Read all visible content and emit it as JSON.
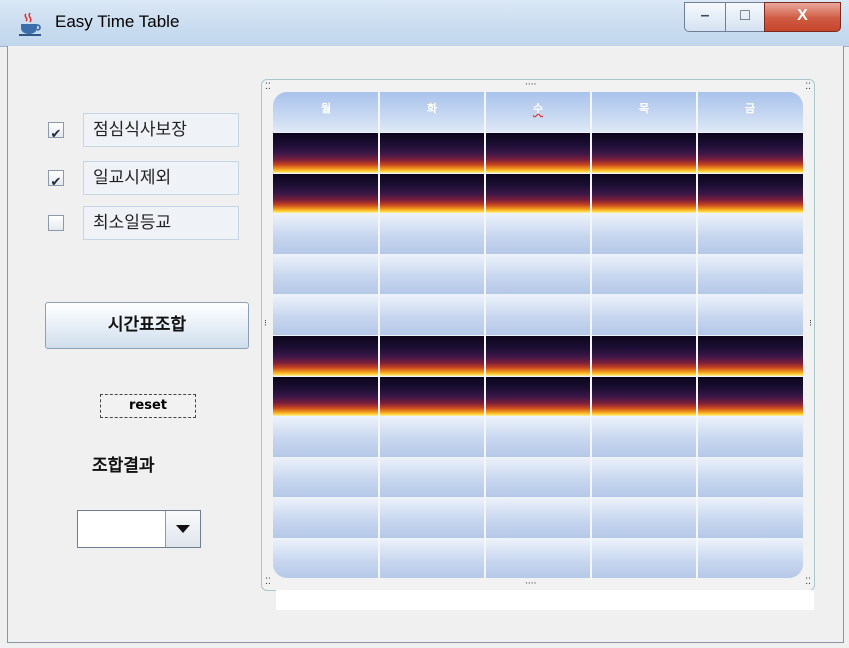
{
  "window": {
    "title": "Easy Time Table",
    "minimize_glyph": "–",
    "maximize_glyph": "□",
    "close_glyph": "X"
  },
  "options": [
    {
      "label": "점심식사보장",
      "checked": true
    },
    {
      "label": "일교시제외",
      "checked": true
    },
    {
      "label": "최소일등교",
      "checked": false
    }
  ],
  "checkmark": "✔",
  "combine_button": "시간표조합",
  "reset_button": "reset",
  "result_label": "조합결과",
  "result_combo": {
    "value": ""
  },
  "timetable": {
    "days": [
      "월",
      "화",
      "수",
      "목",
      "금"
    ],
    "periods": [
      {
        "occupied": true
      },
      {
        "occupied": true
      },
      {
        "occupied": false
      },
      {
        "occupied": false
      },
      {
        "occupied": false
      },
      {
        "occupied": true
      },
      {
        "occupied": true
      },
      {
        "occupied": false
      },
      {
        "occupied": false
      },
      {
        "occupied": false
      },
      {
        "occupied": false
      }
    ]
  },
  "colors": {
    "occupied_dark": "#0b0418",
    "occupied_bright": "#ffd33a",
    "empty_cell": "#c8d7ef",
    "close_button": "#cf5a43"
  }
}
